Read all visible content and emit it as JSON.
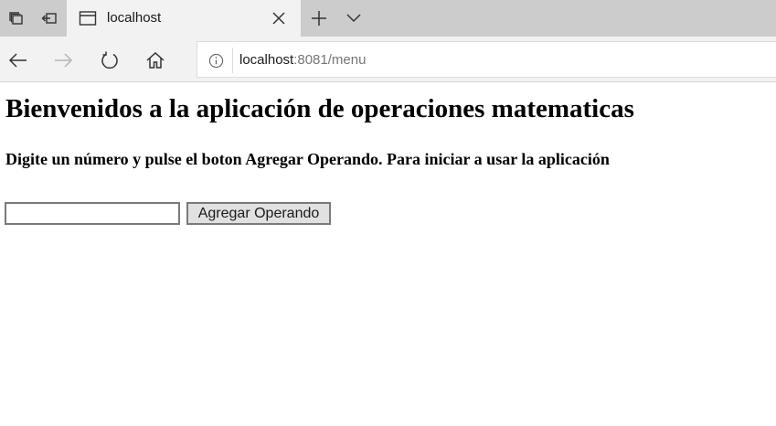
{
  "browser": {
    "tab": {
      "title": "localhost"
    },
    "address_bar": {
      "url_host": "localhost",
      "url_rest": ":8081/menu"
    }
  },
  "page": {
    "title": "Bienvenidos a la aplicación de operaciones matematicas",
    "instructions": "Digite un número y pulse el boton Agregar Operando. Para iniciar a usar la aplicación",
    "number_input": {
      "value": "",
      "placeholder": ""
    },
    "add_button_label": "Agregar Operando"
  },
  "icons": {
    "tab_actions": "tab-actions-icon",
    "set_aside_tabs": "set-aside-tabs-icon",
    "tab_favicon": "page-favicon-icon",
    "close_tab": "close-icon",
    "new_tab": "plus-icon",
    "tab_list": "chevron-down-icon",
    "back": "back-arrow-icon",
    "forward": "forward-arrow-icon",
    "refresh": "refresh-icon",
    "home": "home-icon",
    "site_info": "info-icon"
  },
  "colors": {
    "tabstrip_bg": "#cccccc",
    "active_tab_bg": "#f2f2f2",
    "navbar_bg": "#f2f2f2",
    "button_bg": "#e1e1e1"
  }
}
